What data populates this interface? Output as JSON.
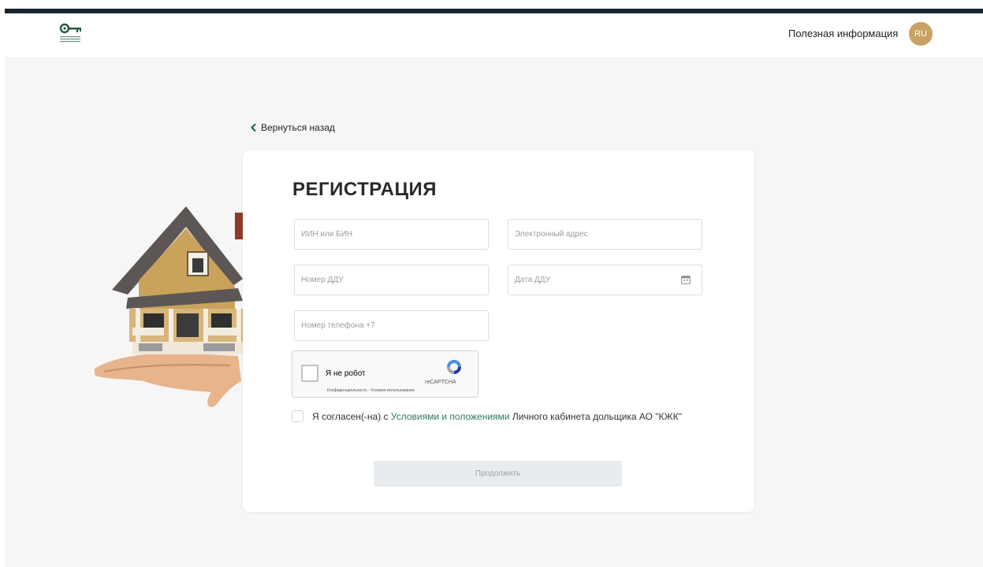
{
  "header": {
    "link_label": "Полезная информация",
    "lang_label": "RU"
  },
  "back_label": "Вернуться назад",
  "form": {
    "title": "РЕГИСТРАЦИЯ",
    "fields": {
      "iin_placeholder": "ИИН или БИН",
      "email_placeholder": "Электронный адрес",
      "ddu_number_placeholder": "Номер ДДУ",
      "ddu_date_placeholder": "Дата ДДУ",
      "phone_placeholder": "Номер телефона +7"
    },
    "captcha": {
      "label": "Я не робот",
      "brand": "reCAPTCHA",
      "links": "Конфиденциальность - Условия использования"
    },
    "agree": {
      "prefix": "Я согласен(-на) с",
      "link": "Условиями и положениями",
      "suffix": "Личного кабинета дольщика АО \"КЖК\""
    },
    "submit_label": "Продолжить"
  },
  "colors": {
    "accent_green": "#2f7a5a",
    "lang_badge": "#c8a264",
    "top_stripe": "#1c2630"
  }
}
